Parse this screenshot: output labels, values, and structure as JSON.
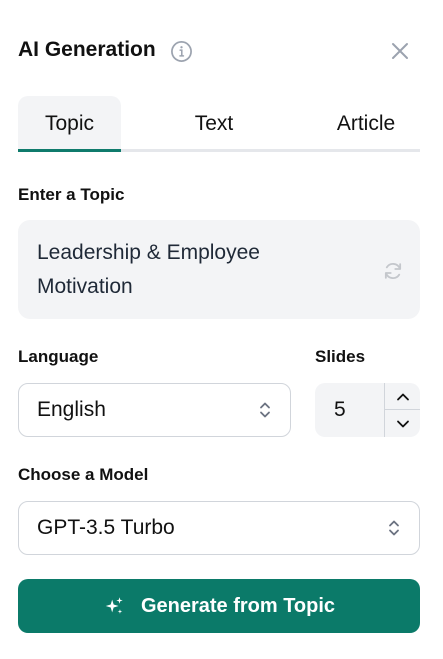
{
  "header": {
    "title": "AI Generation",
    "info_icon": "info-icon",
    "close_icon": "close-icon"
  },
  "tabs": [
    {
      "label": "Topic",
      "active": true
    },
    {
      "label": "Text",
      "active": false
    },
    {
      "label": "Article",
      "active": false
    }
  ],
  "topic": {
    "label": "Enter a Topic",
    "value": "Leadership & Employee Motivation",
    "refresh_icon": "refresh-icon"
  },
  "language": {
    "label": "Language",
    "value": "English",
    "icon": "chevron-updown-icon"
  },
  "slides": {
    "label": "Slides",
    "value": "5",
    "increment_icon": "chevron-up-icon",
    "decrement_icon": "chevron-down-icon"
  },
  "model": {
    "label": "Choose a Model",
    "value": "GPT-3.5 Turbo",
    "icon": "chevron-updown-icon"
  },
  "generate": {
    "label": "Generate from Topic",
    "icon": "sparkle-icon"
  },
  "colors": {
    "accent": "#0b7a69",
    "field_bg": "#f3f4f6",
    "border": "#d1d5db"
  }
}
